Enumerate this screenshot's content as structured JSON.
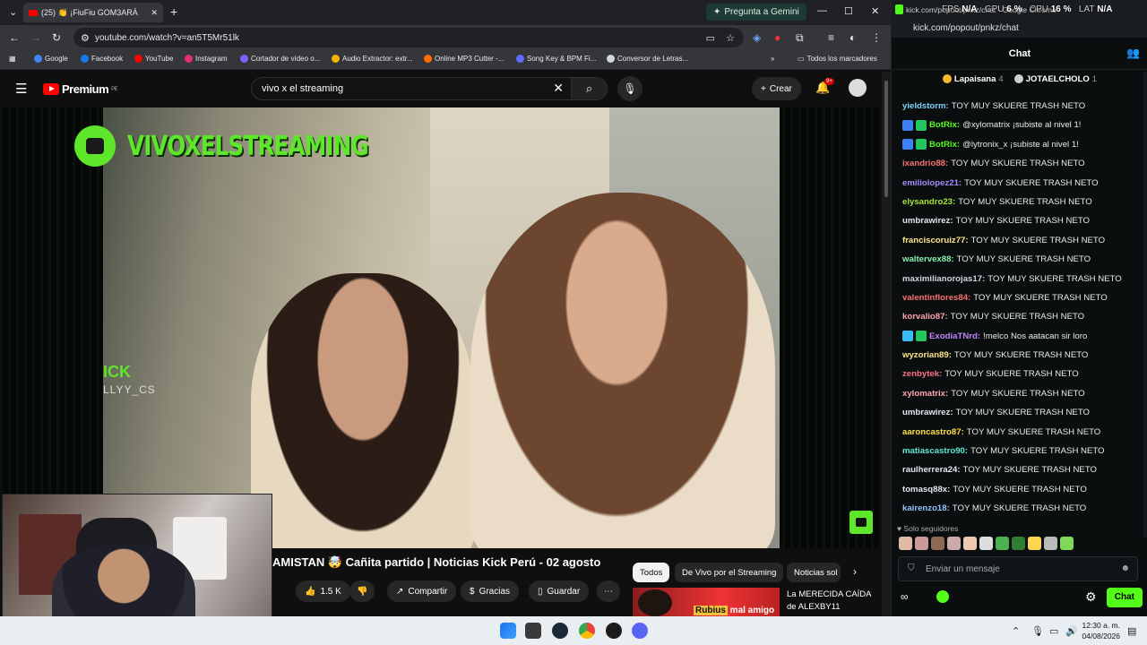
{
  "browser": {
    "tab_title": "(25) 👏 ¡FiuFiu GOM3ARÁ",
    "gemini_label": "Pregunta a Gemini",
    "url": "youtube.com/watch?v=an5T5Mr51lk",
    "bookmarks": [
      {
        "label": "Google",
        "color": "#4285f4"
      },
      {
        "label": "Facebook",
        "color": "#1877f2"
      },
      {
        "label": "YouTube",
        "color": "#ff0000"
      },
      {
        "label": "Instagram",
        "color": "#e1306c"
      },
      {
        "label": "Cortador de vídeo o...",
        "color": "#7b61ff"
      },
      {
        "label": "Audio Extractor: extr...",
        "color": "#f4b400"
      },
      {
        "label": "Online MP3 Cutter -...",
        "color": "#ff6d00"
      },
      {
        "label": "Song Key & BPM Fi...",
        "color": "#5e6cff"
      },
      {
        "label": "Conversor de Letras...",
        "color": "#cfd8dc"
      }
    ],
    "all_bookmarks": "Todos los marcadores"
  },
  "youtube": {
    "logo": "Premium",
    "logo_country": "PE",
    "search_value": "vivo x el streaming",
    "create_label": "Crear",
    "notif_badge": "9+",
    "video": {
      "channel_overlay": "VIVOXELSTREAMING",
      "kick_overlay": "ICK",
      "kick_user_overlay": "LLYY_CS"
    },
    "title": "AMISTAN 🤯 Cañita partido | Noticias Kick Perú - 02 agosto",
    "likes": "1.5 K",
    "share_label": "Compartir",
    "thanks_label": "Gracias",
    "save_label": "Guardar",
    "chips": [
      "Todos",
      "De Vivo por el Streaming",
      "Noticias sol"
    ],
    "related": {
      "thumb_name": "Rubius",
      "thumb_text": "mal amigo",
      "title": "La MERECIDA CAÍDA de ALEXBY11"
    }
  },
  "kick": {
    "window_title": "kick.com/popout/pnkz/chat - Google Chrome",
    "url": "kick.com/popout/pnkz/chat",
    "perf": {
      "fps_label": "FPS",
      "fps": "N/A",
      "gpu_label": "GPU",
      "gpu": "6 %",
      "cpu_label": "CPU",
      "cpu": "16 %",
      "lat_label": "LAT",
      "lat": "N/A"
    },
    "header": "Chat",
    "gifters": [
      {
        "rank": "1",
        "name": "Lapaisana",
        "count": "4",
        "color": "#f5b82e"
      },
      {
        "rank": "2",
        "name": "JOTAELCHOLO",
        "count": "1",
        "color": "#cfcfcf"
      }
    ],
    "messages": [
      {
        "user": "yieldstorm:",
        "text": "TOY MUY SKUERE TRASH NETO",
        "color": "#7dd3fc",
        "badges": []
      },
      {
        "user": "BotRix:",
        "text": "@xylomatrix ¡subiste al nivel 1!",
        "color": "#53fc18",
        "badges": [
          "#3b82f6",
          "#22c55e"
        ]
      },
      {
        "user": "BotRix:",
        "text": "@lytronix_x ¡subiste al nivel 1!",
        "color": "#53fc18",
        "badges": [
          "#3b82f6",
          "#22c55e"
        ]
      },
      {
        "user": "ixandrio88:",
        "text": "TOY MUY SKUERE TRASH NETO",
        "color": "#f87171",
        "badges": []
      },
      {
        "user": "emiliolopez21:",
        "text": "TOY MUY SKUERE TRASH NETO",
        "color": "#a78bfa",
        "badges": []
      },
      {
        "user": "elysandro23:",
        "text": "TOY MUY SKUERE TRASH NETO",
        "color": "#a3e635",
        "badges": []
      },
      {
        "user": "umbrawirez:",
        "text": "TOY MUY SKUERE TRASH NETO",
        "color": "#e5e7eb",
        "badges": []
      },
      {
        "user": "franciscoruiz77:",
        "text": "TOY MUY SKUERE TRASH NETO",
        "color": "#fde68a",
        "badges": []
      },
      {
        "user": "waltervex88:",
        "text": "TOY MUY SKUERE TRASH NETO",
        "color": "#86efac",
        "badges": []
      },
      {
        "user": "maximilianorojas17:",
        "text": "TOY MUY SKUERE TRASH NETO",
        "color": "#d1d5db",
        "badges": []
      },
      {
        "user": "valentinflores84:",
        "text": "TOY MUY SKUERE TRASH NETO",
        "color": "#f87171",
        "badges": []
      },
      {
        "user": "korvalio87:",
        "text": "TOY MUY SKUERE TRASH NETO",
        "color": "#fda4af",
        "badges": []
      },
      {
        "user": "ExodiaTNrd:",
        "text": "!melco Nos aatacan sir loro",
        "color": "#c084fc",
        "badges": [
          "#38bdf8",
          "#22c55e"
        ]
      },
      {
        "user": "wyzorian89:",
        "text": "TOY MUY SKUERE TRASH NETO",
        "color": "#fde68a",
        "badges": []
      },
      {
        "user": "zenbytek:",
        "text": "TOY MUY SKUERE TRASH NETO",
        "color": "#fb7185",
        "badges": []
      },
      {
        "user": "xylomatrix:",
        "text": "TOY MUY SKUERE TRASH NETO",
        "color": "#fda4af",
        "badges": []
      },
      {
        "user": "umbrawirez:",
        "text": "TOY MUY SKUERE TRASH NETO",
        "color": "#e5e7eb",
        "badges": []
      },
      {
        "user": "aaroncastro87:",
        "text": "TOY MUY SKUERE TRASH NETO",
        "color": "#fde047",
        "badges": []
      },
      {
        "user": "matiascastro90:",
        "text": "TOY MUY SKUERE TRASH NETO",
        "color": "#5eead4",
        "badges": []
      },
      {
        "user": "raulherrera24:",
        "text": "TOY MUY SKUERE TRASH NETO",
        "color": "#e5e7eb",
        "badges": []
      },
      {
        "user": "tomasq88x:",
        "text": "TOY MUY SKUERE TRASH NETO",
        "color": "#e5e7eb",
        "badges": []
      },
      {
        "user": "kairenzo18:",
        "text": "TOY MUY SKUERE TRASH NETO",
        "color": "#93c5fd",
        "badges": []
      }
    ],
    "followers_only": "Solo seguidores",
    "input_placeholder": "Enviar un mensaje",
    "chat_button": "Chat"
  },
  "taskbar": {
    "time": "12:30 a. m.",
    "date": "04/08/2026"
  }
}
